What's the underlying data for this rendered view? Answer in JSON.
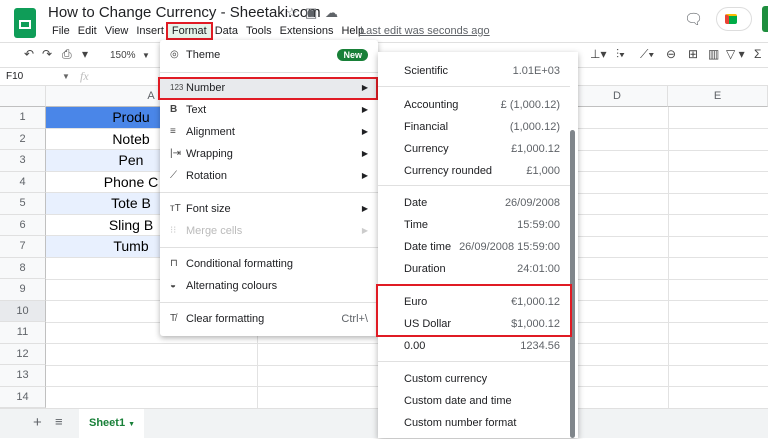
{
  "app": {
    "title": "How to Change Currency - Sheetaki.com",
    "last_edit": "Last edit was seconds ago"
  },
  "menubar": [
    "File",
    "Edit",
    "View",
    "Insert",
    "Format",
    "Data",
    "Tools",
    "Extensions",
    "Help"
  ],
  "toolbar": {
    "zoom": "150%"
  },
  "formula_bar": {
    "cell_ref": "F10",
    "fx": "fx"
  },
  "columns": [
    "A",
    "D",
    "E"
  ],
  "rows": [
    "1",
    "2",
    "3",
    "4",
    "5",
    "6",
    "7",
    "8",
    "9",
    "10",
    "11",
    "12",
    "13",
    "14"
  ],
  "cells_a": [
    "Produ",
    "Noteb",
    "Pen",
    "Phone C",
    "Tote B",
    "Sling B",
    "Tumb"
  ],
  "sheet_tab": "Sheet1",
  "format_menu": {
    "theme": "Theme",
    "new_badge": "New",
    "number": "Number",
    "text": "Text",
    "alignment": "Alignment",
    "wrapping": "Wrapping",
    "rotation": "Rotation",
    "font_size": "Font size",
    "merge_cells": "Merge cells",
    "conditional": "Conditional formatting",
    "alternating": "Alternating colours",
    "clear": "Clear formatting",
    "clear_shortcut": "Ctrl+\\"
  },
  "number_submenu": [
    {
      "label": "Scientific",
      "value": "1.01E+03"
    },
    {
      "label": "Accounting",
      "value": "£ (1,000.12)"
    },
    {
      "label": "Financial",
      "value": "(1,000.12)"
    },
    {
      "label": "Currency",
      "value": "£1,000.12"
    },
    {
      "label": "Currency rounded",
      "value": "£1,000"
    },
    {
      "label": "Date",
      "value": "26/09/2008"
    },
    {
      "label": "Time",
      "value": "15:59:00"
    },
    {
      "label": "Date time",
      "value": "26/09/2008 15:59:00"
    },
    {
      "label": "Duration",
      "value": "24:01:00"
    },
    {
      "label": "Euro",
      "value": "€1,000.12"
    },
    {
      "label": "US Dollar",
      "value": "$1,000.12"
    },
    {
      "label": "0.00",
      "value": "1234.56"
    },
    {
      "label": "Custom currency",
      "value": ""
    },
    {
      "label": "Custom date and time",
      "value": ""
    },
    {
      "label": "Custom number format",
      "value": ""
    }
  ],
  "colors": {
    "highlight": "#e01b24",
    "header_fill": "#4a86e8",
    "band": "#e8f0fe",
    "accent": "#188038"
  }
}
